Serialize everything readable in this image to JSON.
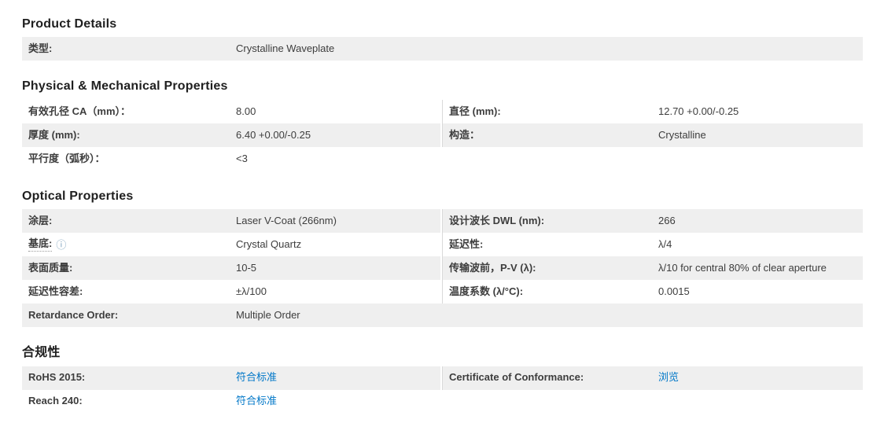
{
  "colors": {
    "link_blue": "#0077c8",
    "shaded_row_bg": "#efefef",
    "column_divider": "#d9d9d9",
    "heading_text": "#1f1f1f",
    "body_text": "#3d3d3d"
  },
  "icons": {
    "info_icon": "ⓘ"
  },
  "sections": [
    {
      "title": "Product Details",
      "rows": [
        {
          "left_label": "类型:",
          "left_value": "Crystalline Waveplate",
          "right_label": "",
          "right_value": ""
        }
      ]
    },
    {
      "title": "Physical & Mechanical Properties",
      "rows": [
        {
          "left_label": "有效孔径 CA（mm）：",
          "left_value": "8.00",
          "right_label": "直径 (mm):",
          "right_value": "12.70 +0.00/-0.25"
        },
        {
          "left_label": "厚度 (mm):",
          "left_value": "6.40 +0.00/-0.25",
          "right_label": "构造：",
          "right_value": "Crystalline"
        },
        {
          "left_label": "平行度（弧秒）：",
          "left_value": "<3",
          "right_label": "",
          "right_value": ""
        }
      ]
    },
    {
      "title": "Optical Properties",
      "rows": [
        {
          "left_label": "涂层:",
          "left_value": "Laser V-Coat (266nm)",
          "right_label": "设计波长 DWL (nm):",
          "right_value": "266"
        },
        {
          "left_label": "基底:",
          "left_value": "Crystal Quartz",
          "right_label": "延迟性:",
          "right_value": "λ/4"
        },
        {
          "left_label": "表面质量:",
          "left_value": "10-5",
          "right_label": "传输波前，P-V (λ):",
          "right_value": "λ/10 for central 80% of clear aperture"
        },
        {
          "left_label": "延迟性容差:",
          "left_value": "±λ/100",
          "right_label": "温度系数 (λ/°C):",
          "right_value": "0.0015"
        },
        {
          "left_label": "Retardance Order:",
          "left_value": "Multiple Order",
          "right_label": "",
          "right_value": ""
        }
      ]
    },
    {
      "title": "合规性",
      "rows": [
        {
          "left_label": "RoHS 2015:",
          "left_value": "符合标准",
          "right_label": "Certificate of Conformance:",
          "right_value": "浏览"
        },
        {
          "left_label": "Reach 240:",
          "left_value": "符合标准",
          "right_label": "",
          "right_value": ""
        }
      ]
    }
  ]
}
